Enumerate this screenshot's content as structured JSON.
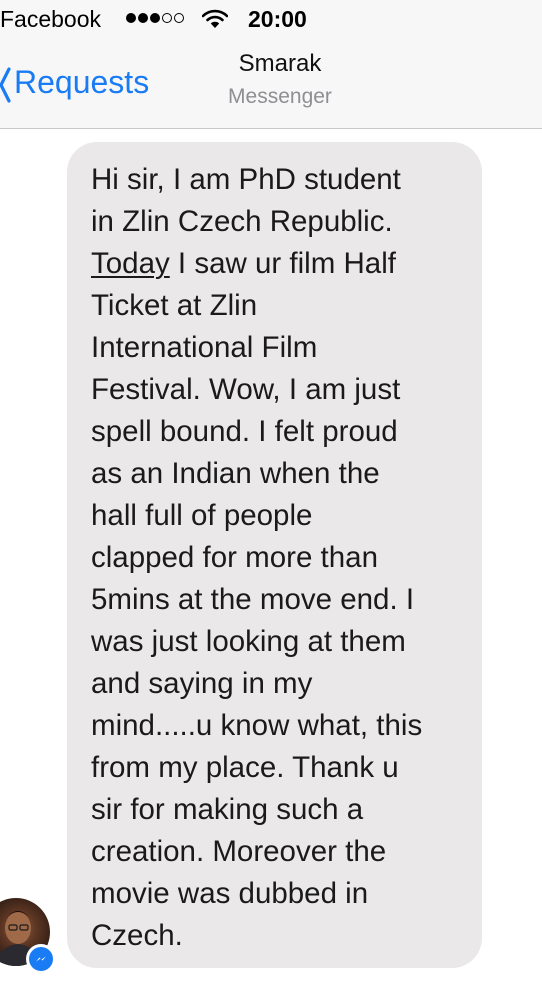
{
  "status_bar": {
    "app_name": "Facebook",
    "time": "20:00",
    "signal_bars": 3,
    "signal_total": 5,
    "icons": [
      "signal-dots-icon",
      "wifi-icon"
    ]
  },
  "nav_bar": {
    "back_label": "Requests",
    "back_icon": "chevron-left-icon",
    "title": "Smarak",
    "subtitle": "Messenger"
  },
  "message": {
    "underlined_word": "Today",
    "text_before": "Hi sir, I am PhD student\nin Zlin Czech Republic.\n",
    "text_after": " I saw ur film Half\nTicket at Zlin\nInternational Film\nFestival. Wow, I am just\nspell bound. I felt proud\nas an Indian when the\nhall full of people\nclapped for more than\n5mins at the move end. I\nwas just looking at them\nand saying in my\nmind.....u know what, this\nfrom my place. Thank u\nsir for making such a\ncreation. Moreover the\nmovie was dubbed in\nCzech."
  },
  "sender": {
    "avatar_icon": "avatar-photo",
    "badge_icon": "messenger-icon"
  },
  "colors": {
    "accent": "#1a7cf5",
    "bubble": "#eae8e9",
    "bar_background": "#f7f7f7",
    "subtitle": "#8e8e93"
  }
}
